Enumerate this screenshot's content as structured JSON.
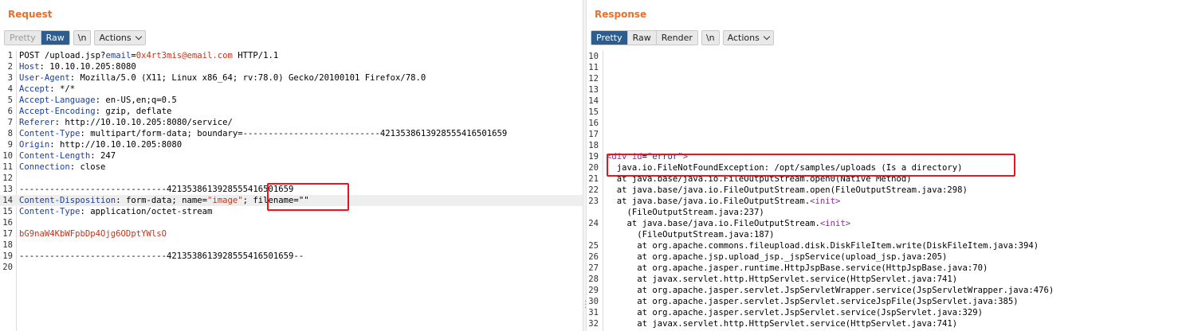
{
  "request": {
    "title": "Request",
    "toolbar": {
      "pretty": "Pretty",
      "raw": "Raw",
      "newline": "\\n",
      "actions": "Actions"
    },
    "lines": [
      {
        "n": "1",
        "segs": [
          {
            "t": "POST /upload.jsp?",
            "c": ""
          },
          {
            "t": "email",
            "c": "k"
          },
          {
            "t": "=",
            "c": ""
          },
          {
            "t": "0x4rt3mis@email.com",
            "c": "v"
          },
          {
            "t": " HTTP/1.1",
            "c": ""
          }
        ]
      },
      {
        "n": "2",
        "segs": [
          {
            "t": "Host",
            "c": "k"
          },
          {
            "t": ": 10.10.10.205:8080",
            "c": ""
          }
        ]
      },
      {
        "n": "3",
        "segs": [
          {
            "t": "User-Agent",
            "c": "k"
          },
          {
            "t": ": Mozilla/5.0 (X11; Linux x86_64; rv:78.0) Gecko/20100101 Firefox/78.0",
            "c": ""
          }
        ]
      },
      {
        "n": "4",
        "segs": [
          {
            "t": "Accept",
            "c": "k"
          },
          {
            "t": ": */*",
            "c": ""
          }
        ]
      },
      {
        "n": "5",
        "segs": [
          {
            "t": "Accept-Language",
            "c": "k"
          },
          {
            "t": ": en-US,en;q=0.5",
            "c": ""
          }
        ]
      },
      {
        "n": "6",
        "segs": [
          {
            "t": "Accept-Encoding",
            "c": "k"
          },
          {
            "t": ": gzip, deflate",
            "c": ""
          }
        ]
      },
      {
        "n": "7",
        "segs": [
          {
            "t": "Referer",
            "c": "k"
          },
          {
            "t": ": http://10.10.10.205:8080/service/",
            "c": ""
          }
        ]
      },
      {
        "n": "8",
        "segs": [
          {
            "t": "Content-Type",
            "c": "k"
          },
          {
            "t": ": multipart/form-data; boundary=---------------------------421353861392855541650165​9",
            "c": ""
          }
        ]
      },
      {
        "n": "9",
        "segs": [
          {
            "t": "Origin",
            "c": "k"
          },
          {
            "t": ": http://10.10.10.205:8080",
            "c": ""
          }
        ]
      },
      {
        "n": "10",
        "segs": [
          {
            "t": "Content-Length",
            "c": "k"
          },
          {
            "t": ": 247",
            "c": ""
          }
        ]
      },
      {
        "n": "11",
        "segs": [
          {
            "t": "Connection",
            "c": "k"
          },
          {
            "t": ": close",
            "c": ""
          }
        ]
      },
      {
        "n": "12",
        "segs": []
      },
      {
        "n": "13",
        "segs": [
          {
            "t": "-----------------------------421353861392855541650165​9",
            "c": ""
          }
        ]
      },
      {
        "n": "14",
        "hl": true,
        "segs": [
          {
            "t": "Content-Disposition",
            "c": "k"
          },
          {
            "t": ": form-data; name=",
            "c": ""
          },
          {
            "t": "\"image\"",
            "c": "v"
          },
          {
            "t": "; filename=\"\"",
            "c": ""
          }
        ]
      },
      {
        "n": "15",
        "segs": [
          {
            "t": "Content-Type",
            "c": "k"
          },
          {
            "t": ": application/octet-stream",
            "c": ""
          }
        ]
      },
      {
        "n": "16",
        "segs": []
      },
      {
        "n": "17",
        "segs": [
          {
            "t": "bG9naW4KbWFpbDp4Ojg6ODptYWlsO",
            "c": "v"
          }
        ]
      },
      {
        "n": "18",
        "segs": []
      },
      {
        "n": "19",
        "segs": [
          {
            "t": "-----------------------------421353861392855541650165​9--",
            "c": ""
          }
        ]
      },
      {
        "n": "20",
        "segs": []
      }
    ]
  },
  "response": {
    "title": "Response",
    "toolbar": {
      "pretty": "Pretty",
      "raw": "Raw",
      "render": "Render",
      "newline": "\\n",
      "actions": "Actions"
    },
    "lines": [
      {
        "n": "10",
        "segs": []
      },
      {
        "n": "11",
        "segs": []
      },
      {
        "n": "12",
        "segs": []
      },
      {
        "n": "13",
        "segs": []
      },
      {
        "n": "14",
        "segs": []
      },
      {
        "n": "15",
        "segs": []
      },
      {
        "n": "16",
        "segs": []
      },
      {
        "n": "17",
        "segs": []
      },
      {
        "n": "18",
        "segs": []
      },
      {
        "n": "19",
        "segs": [
          {
            "t": "<div ",
            "c": "tag"
          },
          {
            "t": "id",
            "c": "tag"
          },
          {
            "t": "=",
            "c": ""
          },
          {
            "t": "\"error\"",
            "c": "str"
          },
          {
            "t": ">",
            "c": "tag"
          }
        ]
      },
      {
        "n": "20",
        "segs": [
          {
            "t": "  java.io.FileNotFoundException: /opt/samples/uploads (Is a directory)",
            "c": ""
          }
        ]
      },
      {
        "n": "21",
        "segs": [
          {
            "t": "  at java.base/java.io.FileOutputStream.open0(Native Method)",
            "c": ""
          }
        ]
      },
      {
        "n": "22",
        "segs": [
          {
            "t": "  at java.base/java.io.FileOutputStream.open(FileOutputStream.java:298)",
            "c": ""
          }
        ]
      },
      {
        "n": "23",
        "segs": [
          {
            "t": "  at java.base/java.io.FileOutputStream.",
            "c": ""
          },
          {
            "t": "<init>",
            "c": "tag"
          }
        ]
      },
      {
        "n": "",
        "segs": [
          {
            "t": "    (FileOutputStream.java:237)",
            "c": ""
          }
        ]
      },
      {
        "n": "24",
        "segs": [
          {
            "t": "    at java.base/java.io.FileOutputStream.",
            "c": ""
          },
          {
            "t": "<init>",
            "c": "tag"
          }
        ]
      },
      {
        "n": "",
        "segs": [
          {
            "t": "      (FileOutputStream.java:187)",
            "c": ""
          }
        ]
      },
      {
        "n": "25",
        "segs": [
          {
            "t": "      at org.apache.commons.fileupload.disk.DiskFileItem.write(DiskFileItem.java:394)",
            "c": ""
          }
        ]
      },
      {
        "n": "26",
        "segs": [
          {
            "t": "      at org.apache.jsp.upload_jsp._jspService(upload_jsp.java:205)",
            "c": ""
          }
        ]
      },
      {
        "n": "27",
        "segs": [
          {
            "t": "      at org.apache.jasper.runtime.HttpJspBase.service(HttpJspBase.java:70)",
            "c": ""
          }
        ]
      },
      {
        "n": "28",
        "segs": [
          {
            "t": "      at javax.servlet.http.HttpServlet.service(HttpServlet.java:741)",
            "c": ""
          }
        ]
      },
      {
        "n": "29",
        "segs": [
          {
            "t": "      at org.apache.jasper.servlet.JspServletWrapper.service(JspServletWrapper.java:476)",
            "c": ""
          }
        ]
      },
      {
        "n": "30",
        "segs": [
          {
            "t": "      at org.apache.jasper.servlet.JspServlet.serviceJspFile(JspServlet.java:385)",
            "c": ""
          }
        ]
      },
      {
        "n": "31",
        "segs": [
          {
            "t": "      at org.apache.jasper.servlet.JspServlet.service(JspServlet.java:329)",
            "c": ""
          }
        ]
      },
      {
        "n": "32",
        "segs": [
          {
            "t": "      at javax.servlet.http.HttpServlet.service(HttpServlet.java:741)",
            "c": ""
          }
        ]
      }
    ]
  },
  "colors": {
    "title": "#e8702a",
    "active": "#2d5d8f",
    "key": "#1b3e9a",
    "value": "#c4341c",
    "tag": "#8a2b9c",
    "annotation": "#e8141e"
  }
}
